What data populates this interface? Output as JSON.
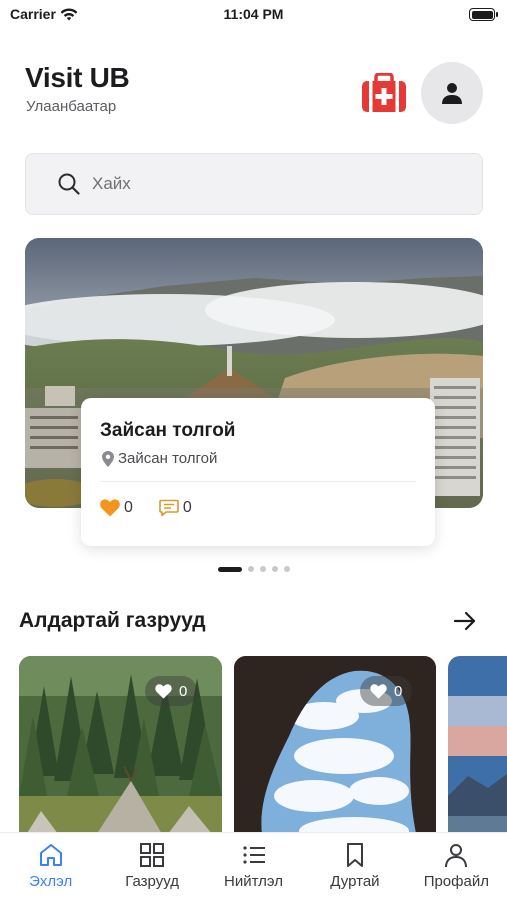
{
  "status_bar": {
    "carrier": "Carrier",
    "time": "11:04 PM",
    "battery_level": 1.0
  },
  "header": {
    "title": "Visit UB",
    "subtitle": "Улаанбаатар",
    "first_aid_icon": "first-aid-kit-icon",
    "avatar_icon": "user-icon"
  },
  "search": {
    "placeholder": "Хайх",
    "icon": "search-icon"
  },
  "featured": {
    "title": "Зайсан толгой",
    "location": "Зайсан толгой",
    "likes": "0",
    "comments": "0",
    "like_color": "#f5941d",
    "comment_color": "#d99a2b"
  },
  "pager": {
    "count": 5,
    "active_index": 0
  },
  "popular": {
    "title": "Алдартай газрууд",
    "arrow_icon": "arrow-right-icon",
    "cards": [
      {
        "likes": "0",
        "image": "forest-camp"
      },
      {
        "likes": "0",
        "image": "cave-sky"
      },
      {
        "image": "mountain-dusk"
      }
    ]
  },
  "tab_bar": {
    "active_color": "#3b82f6",
    "tabs": [
      {
        "label": "Эхлэл",
        "icon": "home-icon",
        "active": true
      },
      {
        "label": "Газрууд",
        "icon": "grid-icon",
        "active": false
      },
      {
        "label": "Нийтлэл",
        "icon": "list-icon",
        "active": false
      },
      {
        "label": "Дуртай",
        "icon": "bookmark-icon",
        "active": false
      },
      {
        "label": "Профайл",
        "icon": "person-icon",
        "active": false
      }
    ]
  }
}
